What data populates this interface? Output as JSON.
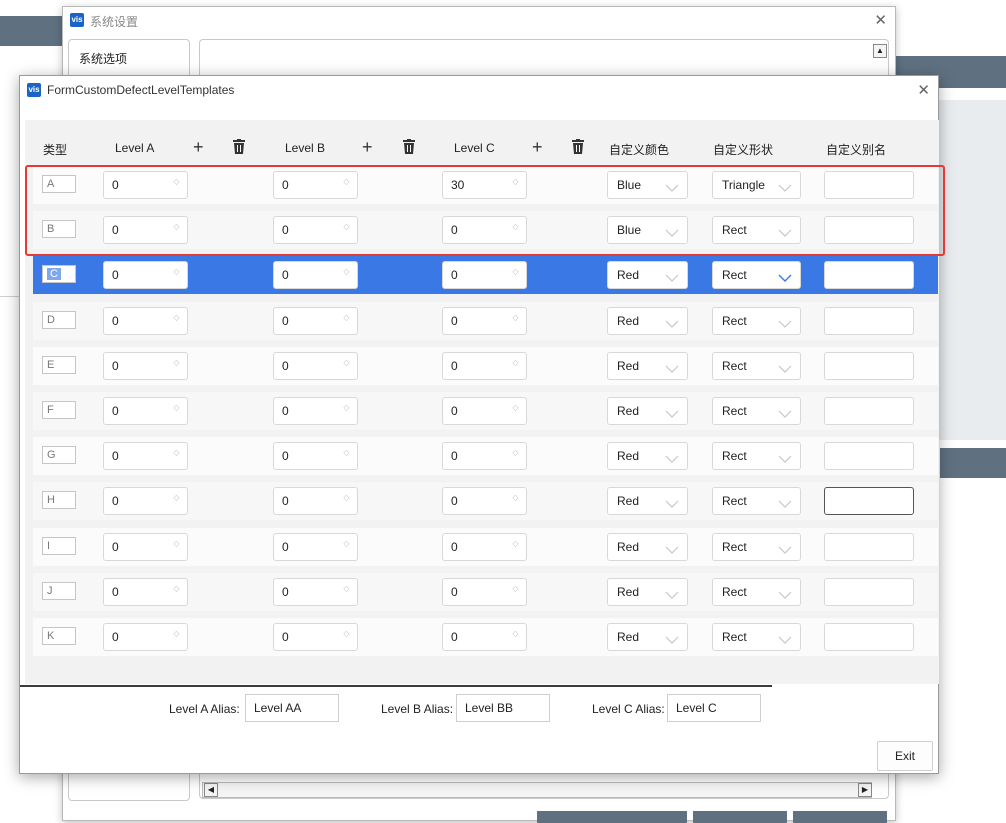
{
  "bg_dialog": {
    "title": "系统设置",
    "sidebar_item": "系统选项"
  },
  "dialog": {
    "title": "FormCustomDefectLevelTemplates",
    "headers": {
      "type": "类型",
      "level_a": "Level A",
      "level_b": "Level B",
      "level_c": "Level C",
      "color": "自定义颜色",
      "shape": "自定义形状",
      "alias": "自定义别名"
    },
    "rows": [
      {
        "type": "A",
        "a": "0",
        "b": "0",
        "c": "30",
        "color": "Blue",
        "shape": "Triangle",
        "alias": ""
      },
      {
        "type": "B",
        "a": "0",
        "b": "0",
        "c": "0",
        "color": "Blue",
        "shape": "Rect",
        "alias": ""
      },
      {
        "type": "C",
        "a": "0",
        "b": "0",
        "c": "0",
        "color": "Red",
        "shape": "Rect",
        "alias": ""
      },
      {
        "type": "D",
        "a": "0",
        "b": "0",
        "c": "0",
        "color": "Red",
        "shape": "Rect",
        "alias": ""
      },
      {
        "type": "E",
        "a": "0",
        "b": "0",
        "c": "0",
        "color": "Red",
        "shape": "Rect",
        "alias": ""
      },
      {
        "type": "F",
        "a": "0",
        "b": "0",
        "c": "0",
        "color": "Red",
        "shape": "Rect",
        "alias": ""
      },
      {
        "type": "G",
        "a": "0",
        "b": "0",
        "c": "0",
        "color": "Red",
        "shape": "Rect",
        "alias": ""
      },
      {
        "type": "H",
        "a": "0",
        "b": "0",
        "c": "0",
        "color": "Red",
        "shape": "Rect",
        "alias": ""
      },
      {
        "type": "I",
        "a": "0",
        "b": "0",
        "c": "0",
        "color": "Red",
        "shape": "Rect",
        "alias": ""
      },
      {
        "type": "J",
        "a": "0",
        "b": "0",
        "c": "0",
        "color": "Red",
        "shape": "Rect",
        "alias": ""
      },
      {
        "type": "K",
        "a": "0",
        "b": "0",
        "c": "0",
        "color": "Red",
        "shape": "Rect",
        "alias": ""
      }
    ],
    "selected_row": "C",
    "alias_fields": {
      "a_label": "Level A Alias:",
      "a_value": "Level AA",
      "b_label": "Level B Alias:",
      "b_value": "Level BB",
      "c_label": "Level C Alias:",
      "c_value": "Level C"
    },
    "exit_label": "Exit"
  },
  "icons": {
    "add": "plus-icon",
    "delete": "trash-icon",
    "logo": "vis-logo-icon",
    "close": "close-icon"
  },
  "colors": {
    "selection": "#3a78e6",
    "highlight_frame": "#e53935"
  }
}
